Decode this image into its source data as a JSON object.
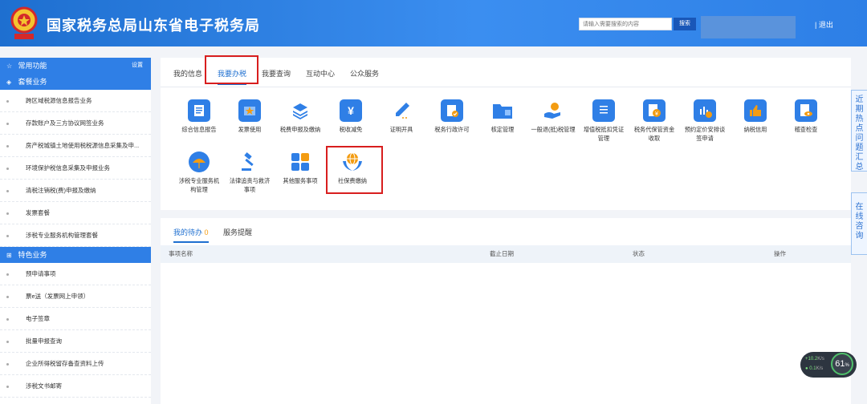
{
  "header": {
    "title": "国家税务总局山东省电子税务局",
    "search_placeholder": "请输入需要搜索的内容",
    "search_button": "搜索",
    "logout": "退出"
  },
  "sidebar": {
    "common_label": "常用功能",
    "settings_label": "设置",
    "package_label": "套餐业务",
    "package_items": [
      "跨区域税源信息报告业务",
      "存款账户及三方协议网签业务",
      "房产税城镇土地使用税税源信息采集及申...",
      "环境保护税信息采集及申报业务",
      "清税注销税(费)申报及缴纳",
      "发票套餐",
      "涉税专业服务机构管理套餐"
    ],
    "special_label": "特色业务",
    "special_items": [
      "预申请事项",
      "票e送（发票网上申领）",
      "电子签章",
      "批量申报查询",
      "企业所得税留存备查资料上传",
      "涉税文书邮寄"
    ]
  },
  "tabs": [
    "我的信息",
    "我要办税",
    "我要查询",
    "互动中心",
    "公众服务"
  ],
  "services": [
    {
      "label": "综合信息报告",
      "icon": "document-icon",
      "color": "#2f7fe6"
    },
    {
      "label": "发票使用",
      "icon": "invoice-star-icon",
      "color": "#2f7fe6"
    },
    {
      "label": "税费申报及缴纳",
      "icon": "layers-icon",
      "color": "#2f7fe6"
    },
    {
      "label": "税收减免",
      "icon": "yuan-ticket-icon",
      "color": "#2f7fe6"
    },
    {
      "label": "证明开具",
      "icon": "pen-icon",
      "color": "#2f7fe6"
    },
    {
      "label": "税务行政许可",
      "icon": "doc-check-icon",
      "color": "#2f7fe6"
    },
    {
      "label": "核定管理",
      "icon": "folder-icon",
      "color": "#2f7fe6"
    },
    {
      "label": "一般退(抵)税管理",
      "icon": "hand-coin-icon",
      "color": "#2f7fe6"
    },
    {
      "label": "增值税抵扣凭证管理",
      "icon": "ledger-icon",
      "color": "#2f7fe6"
    },
    {
      "label": "税务代保管资金收取",
      "icon": "yuan-doc-icon",
      "color": "#2f7fe6"
    },
    {
      "label": "预约定价安排谈签申请",
      "icon": "chart-coin-icon",
      "color": "#2f7fe6"
    },
    {
      "label": "纳税信用",
      "icon": "thumb-up-icon",
      "color": "#2f7fe6"
    },
    {
      "label": "稽查检查",
      "icon": "doc-eye-icon",
      "color": "#2f7fe6"
    },
    {
      "label": "涉税专业服务机构管理",
      "icon": "umbrella-icon",
      "color": "#f39c12"
    },
    {
      "label": "法律追责与救济事项",
      "icon": "gavel-icon",
      "color": "#2f7fe6"
    },
    {
      "label": "其他服务事项",
      "icon": "grid-icon",
      "color": "#2f7fe6"
    },
    {
      "label": "社保费缴纳",
      "icon": "globe-hands-icon",
      "color": "#2f7fe6"
    }
  ],
  "todo": {
    "tab_label": "我的待办",
    "count": "0",
    "reminder_label": "服务提醒",
    "columns": [
      "事项名称",
      "截止日期",
      "状态",
      "操作"
    ]
  },
  "float": {
    "hot_topics": "近期热点问题汇总",
    "online_consult": "在线咨询"
  },
  "network": {
    "up": "+10.2",
    "up_unit": "K/s",
    "down": "0.1",
    "down_unit": "K/s",
    "percent": "61",
    "percent_unit": "%"
  }
}
